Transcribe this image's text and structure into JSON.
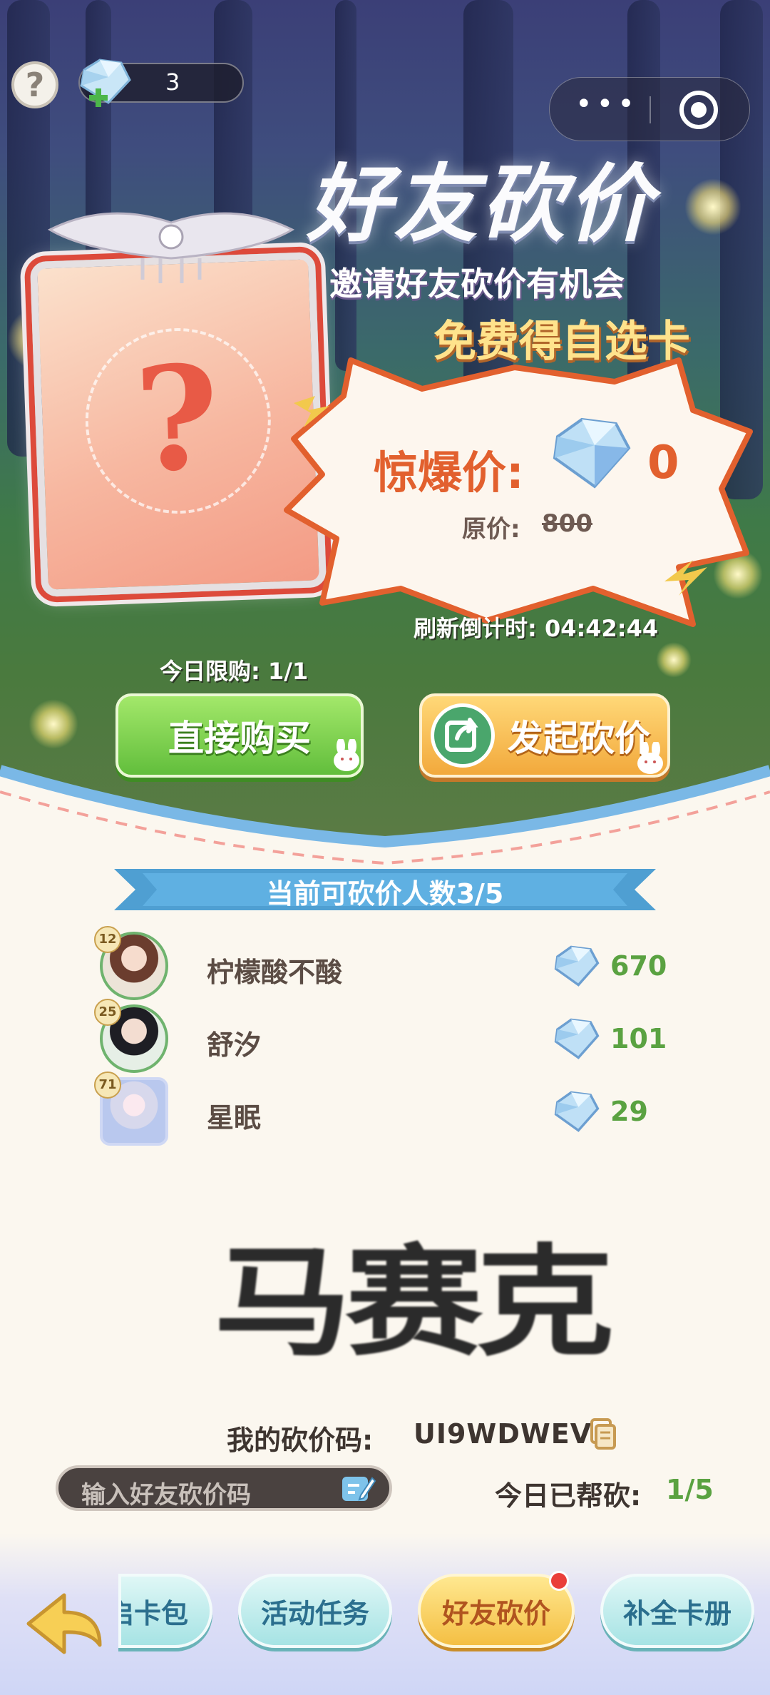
{
  "topbar": {
    "help_icon": "question-mark-icon",
    "gem_count": "3",
    "menu_dots": "•••",
    "close_icon": "target-icon"
  },
  "hero": {
    "title": "好友砍价",
    "subtitle_line1": "邀请好友砍价有机会",
    "subtitle_line2": "免费得自选卡",
    "card_placeholder": "?"
  },
  "price": {
    "label": "惊爆价:",
    "value": "0",
    "original_label": "原价:",
    "original_value": "800",
    "countdown": "刷新倒计时: 04:42:44",
    "daily_limit": "今日限购: 1/1"
  },
  "actions": {
    "buy_label": "直接购买",
    "bargain_label": "发起砍价"
  },
  "helpers": {
    "header": "当前可砍价人数3/5",
    "rows": [
      {
        "level": "12",
        "name": "柠檬酸不酸",
        "amount": "670"
      },
      {
        "level": "25",
        "name": "舒汐",
        "amount": "101"
      },
      {
        "level": "71",
        "name": "星眠",
        "amount": "29"
      }
    ]
  },
  "mosaic_text": "马赛克",
  "code": {
    "label": "我的砍价码:",
    "value": "UI9WDWEV",
    "input_placeholder": "输入好友砍价码",
    "helped_label": "今日已帮砍:",
    "helped_value": "1/5"
  },
  "nav": {
    "partial_label": "启卡包",
    "tasks_label": "活动任务",
    "bargain_label": "好友砍价",
    "album_label": "补全卡册"
  },
  "colors": {
    "accent_orange": "#e2602e",
    "green": "#5aa241",
    "ribbon_blue": "#4f9fd2"
  }
}
